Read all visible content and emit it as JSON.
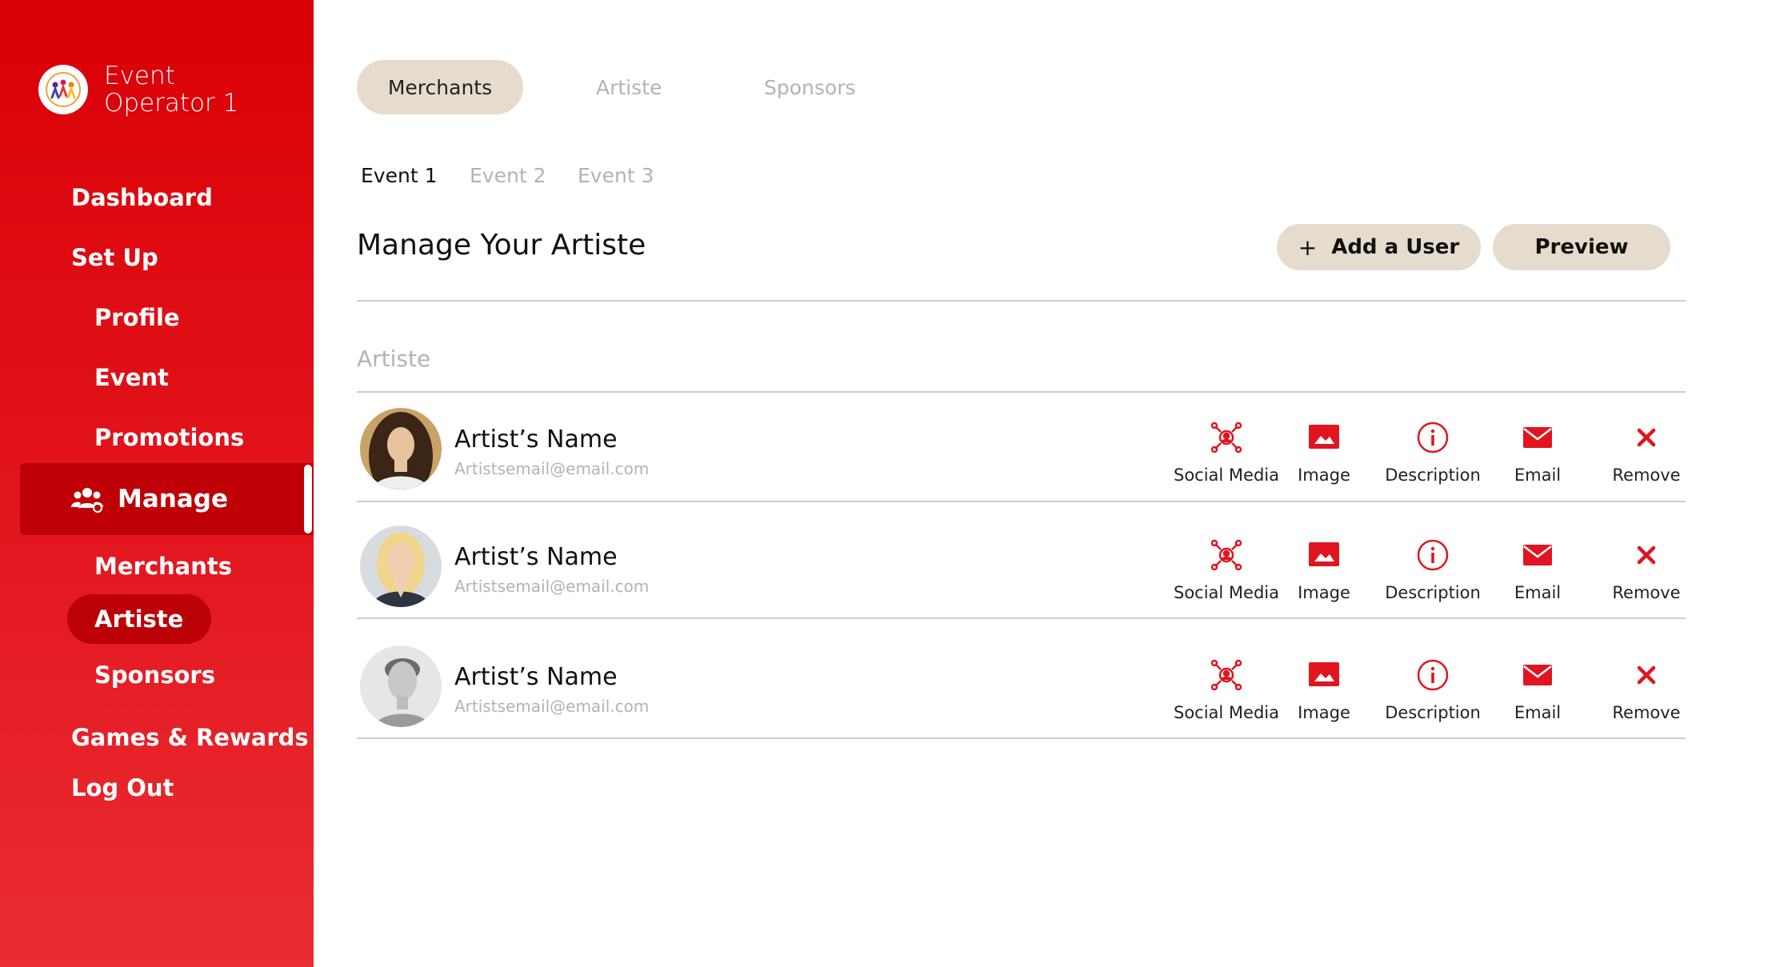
{
  "brand": {
    "name_line1": "Event",
    "name_line2": "Operator 1"
  },
  "nav": {
    "dashboard": "Dashboard",
    "setup": "Set Up",
    "profile": "Profile",
    "event": "Event",
    "promotions": "Promotions",
    "manage": "Manage",
    "merchants": "Merchants",
    "artiste": "Artiste",
    "sponsors": "Sponsors",
    "games_rewards": "Games & Rewards",
    "logout": "Log Out"
  },
  "top_tabs": [
    "Merchants",
    "Artiste",
    "Sponsors"
  ],
  "event_tabs": [
    "Event 1",
    "Event 2",
    "Event 3"
  ],
  "page_title": "Manage Your Artiste",
  "buttons": {
    "add_plus": "+",
    "add_user": "Add a User",
    "preview": "Preview"
  },
  "section_label": "Artiste",
  "actions": {
    "social_media": "Social Media",
    "image": "Image",
    "description": "Description",
    "email": "Email",
    "remove": "Remove"
  },
  "artists": [
    {
      "name": "Artist’s Name",
      "email": "Artistsemail@email.com"
    },
    {
      "name": "Artist’s Name",
      "email": "Artistsemail@email.com"
    },
    {
      "name": "Artist’s Name",
      "email": "Artistsemail@email.com"
    }
  ],
  "colors": {
    "brand_red": "#d90006",
    "accent_beige": "#e5dccd",
    "icon_red": "#e0151f"
  }
}
